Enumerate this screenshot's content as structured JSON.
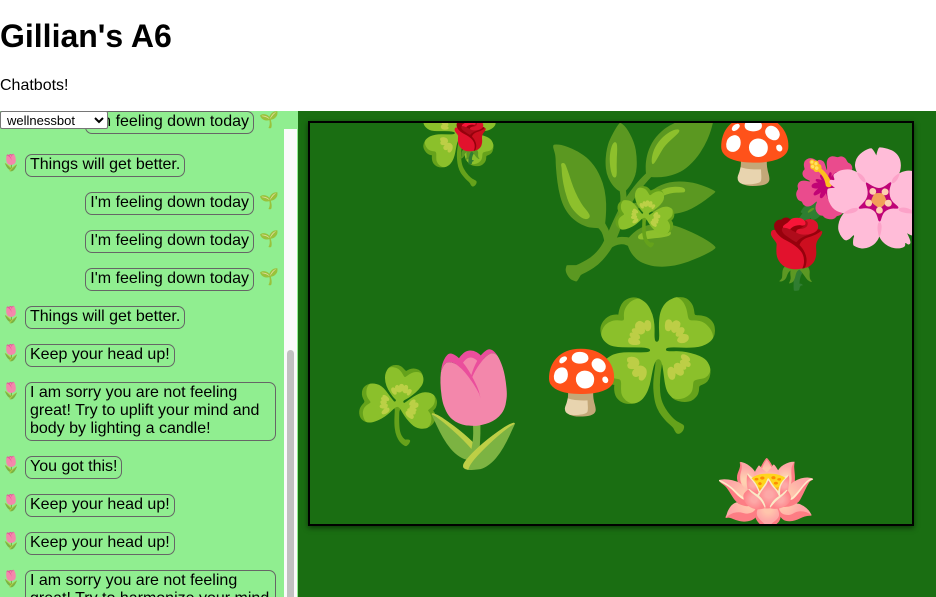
{
  "header": {
    "title": "Gillian's A6",
    "subtitle": "Chatbots!"
  },
  "bot_select": {
    "selected": "wellnessbot",
    "options": [
      "wellnessbot"
    ]
  },
  "messages": [
    {
      "sender": "user",
      "text": "I'm feeling down today"
    },
    {
      "sender": "bot",
      "text": "Things will get better."
    },
    {
      "sender": "user",
      "text": "I'm feeling down today"
    },
    {
      "sender": "user",
      "text": "I'm feeling down today"
    },
    {
      "sender": "user",
      "text": "I'm feeling down today"
    },
    {
      "sender": "bot",
      "text": "Things will get better."
    },
    {
      "sender": "bot",
      "text": "Keep your head up!"
    },
    {
      "sender": "bot",
      "text": "I am sorry you are not feeling great! Try to uplift your mind and body by lighting a candle!"
    },
    {
      "sender": "bot",
      "text": "You got this!"
    },
    {
      "sender": "bot",
      "text": "Keep your head up!"
    },
    {
      "sender": "bot",
      "text": "Keep your head up!"
    },
    {
      "sender": "bot",
      "text": "I am sorry you are not feeling great! Try to harmonize your mind"
    }
  ],
  "avatars": {
    "bot": "🌷",
    "user": "🌱"
  },
  "garden": {
    "items": [
      {
        "name": "clover-icon",
        "glyph": "🍀"
      },
      {
        "name": "rose-icon",
        "glyph": "🌹"
      },
      {
        "name": "herb-icon",
        "glyph": "🌿"
      },
      {
        "name": "mushroom-icon",
        "glyph": "🍄"
      },
      {
        "name": "hibiscus-icon",
        "glyph": "🌺"
      },
      {
        "name": "cherry-blossom-icon",
        "glyph": "🌸"
      },
      {
        "name": "shamrock-icon",
        "glyph": "☘️"
      },
      {
        "name": "rose-icon",
        "glyph": "🌹"
      },
      {
        "name": "clover-icon",
        "glyph": "🍀"
      },
      {
        "name": "mushroom-icon",
        "glyph": "🍄"
      },
      {
        "name": "shamrock-icon",
        "glyph": "☘️"
      },
      {
        "name": "tulip-icon",
        "glyph": "🌷"
      },
      {
        "name": "lotus-icon",
        "glyph": "🪷"
      }
    ]
  },
  "colors": {
    "chat_bg": "#90ee90",
    "garden_bg": "#1a6e12",
    "border": "#000000"
  }
}
